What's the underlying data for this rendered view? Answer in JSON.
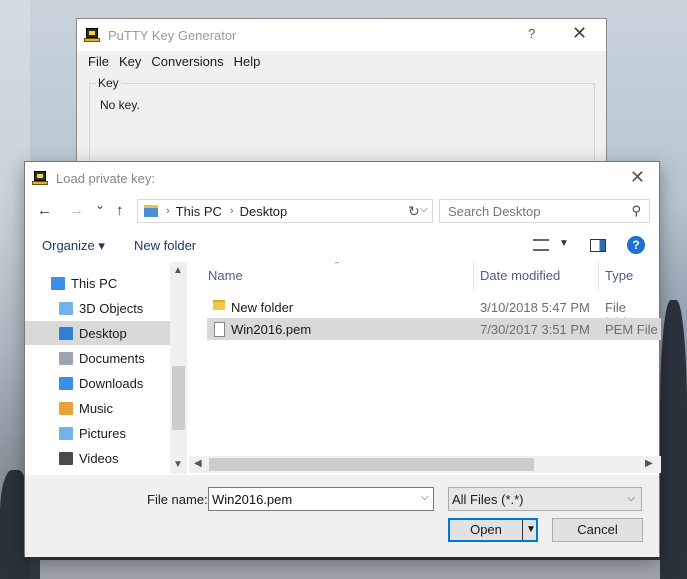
{
  "putty": {
    "title": "PuTTY Key Generator",
    "help": "?",
    "close": "✕",
    "menu": [
      "File",
      "Key",
      "Conversions",
      "Help"
    ],
    "group_label": "Key",
    "key_status": "No key."
  },
  "dialog": {
    "title": "Load private key:",
    "close": "✕",
    "nav": {
      "back": "←",
      "forward": "→",
      "recent": "⌄",
      "up": "↑",
      "refresh": "↻"
    },
    "breadcrumb": [
      "This PC",
      "Desktop"
    ],
    "search_placeholder": "Search Desktop",
    "toolbar": {
      "organize": "Organize ▾",
      "new_folder": "New folder",
      "help": "?"
    },
    "nav_pane": [
      {
        "label": "This PC",
        "icon": "computer-icon",
        "color": "#3a8ee6"
      },
      {
        "label": "3D Objects",
        "icon": "3d-objects-icon",
        "color": "#6fb3ea"
      },
      {
        "label": "Desktop",
        "icon": "desktop-icon",
        "color": "#2f7fd6",
        "selected": true
      },
      {
        "label": "Documents",
        "icon": "documents-icon",
        "color": "#9aa5b1"
      },
      {
        "label": "Downloads",
        "icon": "downloads-icon",
        "color": "#3a8ee6"
      },
      {
        "label": "Music",
        "icon": "music-icon",
        "color": "#e7a23c"
      },
      {
        "label": "Pictures",
        "icon": "pictures-icon",
        "color": "#6fb3ea"
      },
      {
        "label": "Videos",
        "icon": "videos-icon",
        "color": "#4b4b4b"
      }
    ],
    "columns": [
      "Name",
      "Date modified",
      "Type"
    ],
    "files": [
      {
        "name": "New folder",
        "date": "3/10/2018 5:47 PM",
        "type": "File folder",
        "kind": "folder"
      },
      {
        "name": "Win2016.pem",
        "date": "7/30/2017 3:51 PM",
        "type": "PEM File",
        "kind": "file",
        "selected": true
      }
    ],
    "file_name_label": "File name:",
    "file_name_value": "Win2016.pem",
    "file_type": "All Files (*.*)",
    "open_label": "Open",
    "cancel_label": "Cancel"
  }
}
